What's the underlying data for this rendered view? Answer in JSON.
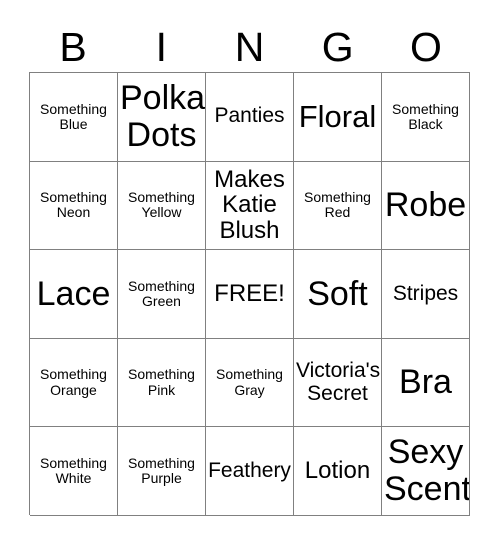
{
  "card": {
    "header_letters": [
      "B",
      "I",
      "N",
      "G",
      "O"
    ],
    "border_color": "#808080",
    "text_color": "#000000",
    "background_color": "#ffffff",
    "free_space_label": "FREE!",
    "rows": [
      [
        {
          "text": "Something Blue",
          "size": "xs"
        },
        {
          "text": "Polka Dots",
          "size": "xxl"
        },
        {
          "text": "Panties",
          "size": "m"
        },
        {
          "text": "Floral",
          "size": "xl"
        },
        {
          "text": "Something Black",
          "size": "xs"
        }
      ],
      [
        {
          "text": "Something Neon",
          "size": "xs"
        },
        {
          "text": "Something Yellow",
          "size": "xs"
        },
        {
          "text": "Makes Katie Blush",
          "size": "ml"
        },
        {
          "text": "Something Red",
          "size": "xs"
        },
        {
          "text": "Robe",
          "size": "xxl"
        }
      ],
      [
        {
          "text": "Lace",
          "size": "xxl"
        },
        {
          "text": "Something Green",
          "size": "xs"
        },
        {
          "text": "FREE!",
          "size": "ml"
        },
        {
          "text": "Soft",
          "size": "xxl"
        },
        {
          "text": "Stripes",
          "size": "m"
        }
      ],
      [
        {
          "text": "Something Orange",
          "size": "xs"
        },
        {
          "text": "Something Pink",
          "size": "xs"
        },
        {
          "text": "Something Gray",
          "size": "xs"
        },
        {
          "text": "Victoria's Secret",
          "size": "m"
        },
        {
          "text": "Bra",
          "size": "xxl"
        }
      ],
      [
        {
          "text": "Something White",
          "size": "xs"
        },
        {
          "text": "Something Purple",
          "size": "xs"
        },
        {
          "text": "Feathery",
          "size": "m"
        },
        {
          "text": "Lotion",
          "size": "ml"
        },
        {
          "text": "Sexy Scent",
          "size": "xxl"
        }
      ]
    ]
  }
}
